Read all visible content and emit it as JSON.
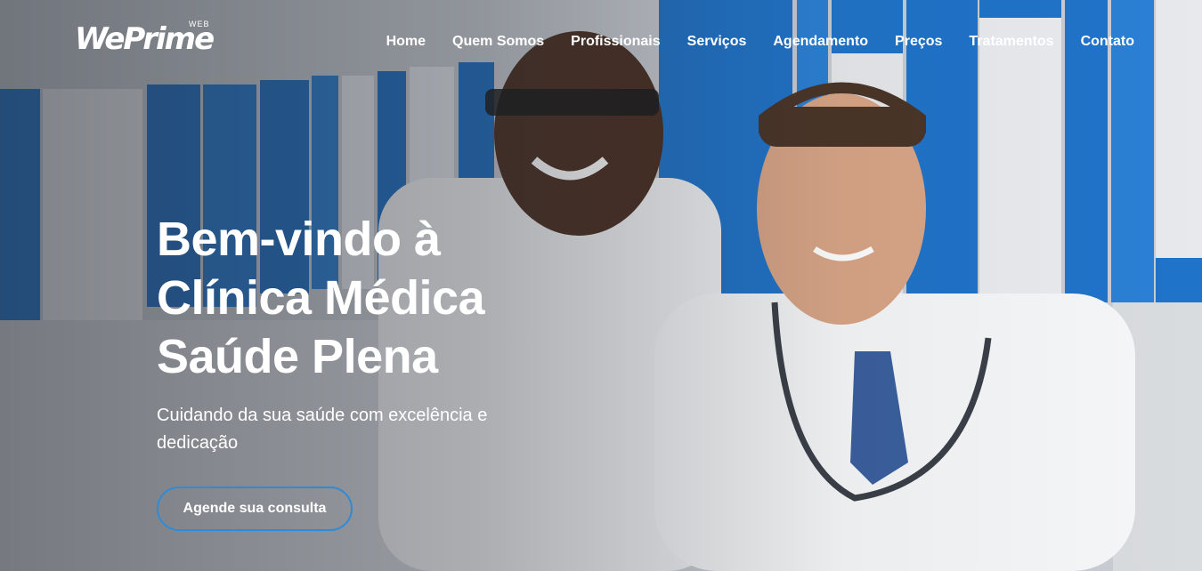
{
  "header": {
    "logo_text": "WePrime",
    "logo_sub": "WEB"
  },
  "nav": {
    "items": [
      {
        "label": "Home"
      },
      {
        "label": "Quem Somos"
      },
      {
        "label": "Profissionais"
      },
      {
        "label": "Serviços"
      },
      {
        "label": "Agendamento"
      },
      {
        "label": "Preços"
      },
      {
        "label": "Tratamentos"
      },
      {
        "label": "Contato"
      }
    ]
  },
  "hero": {
    "title_line1": "Bem-vindo à",
    "title_line2": "Clínica Médica",
    "title_line3": "Saúde Plena",
    "subtitle": "Cuidando da sua saúde com excelência e dedicação",
    "cta_label": "Agende sua consulta"
  },
  "colors": {
    "accent": "#2e8bd8",
    "cabinet_blue": "#1f73c9",
    "text": "#ffffff"
  }
}
